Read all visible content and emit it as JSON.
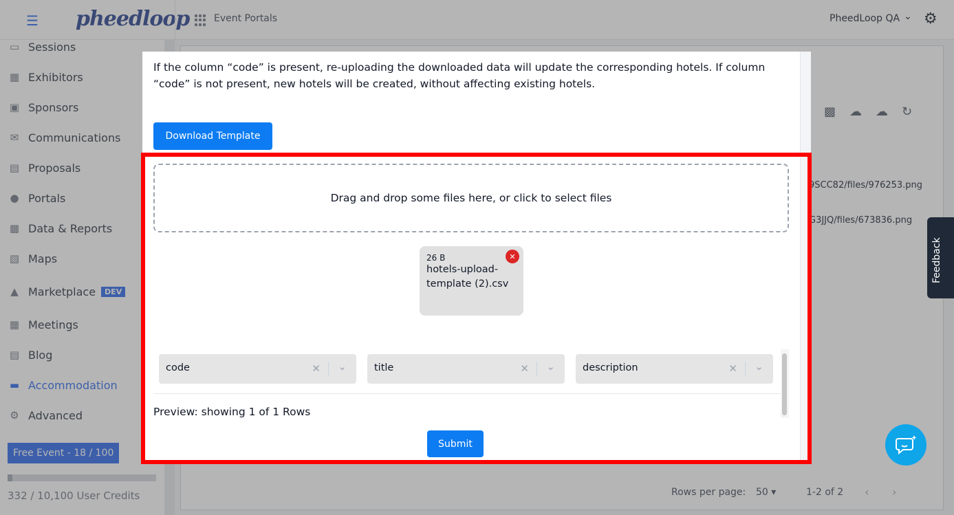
{
  "header": {
    "logo_text": "pheedloop",
    "portal_title": "Event Portals",
    "org_name": "PheedLoop QA"
  },
  "sidebar": {
    "items": [
      {
        "label": "Sessions",
        "icon": "monitor-icon"
      },
      {
        "label": "Exhibitors",
        "icon": "store-icon"
      },
      {
        "label": "Sponsors",
        "icon": "badge-icon"
      },
      {
        "label": "Communications",
        "icon": "mail-icon"
      },
      {
        "label": "Proposals",
        "icon": "document-icon"
      },
      {
        "label": "Portals",
        "icon": "globe-icon"
      },
      {
        "label": "Data & Reports",
        "icon": "chart-icon"
      },
      {
        "label": "Maps",
        "icon": "map-icon"
      },
      {
        "label": "Marketplace",
        "icon": "cart-icon",
        "badge": "DEV"
      },
      {
        "label": "Meetings",
        "icon": "calendar-icon"
      },
      {
        "label": "Blog",
        "icon": "document-icon"
      },
      {
        "label": "Accommodation",
        "icon": "bed-icon",
        "active": true
      },
      {
        "label": "Advanced",
        "icon": "gear-icon"
      }
    ],
    "free_event_label": "Free Event - 18 / 100",
    "credit_usage_fraction": 0.033,
    "credits_label": "332 / 10,100 User Credits"
  },
  "background": {
    "link_1": "9SCC82/files/976253.png",
    "link_2": "G3JJQ/files/673836.png",
    "feedback_label": "Feedback",
    "rows_per_page_label": "Rows per page:",
    "rows_per_page_value": "50",
    "range_label": "1-2 of 2"
  },
  "modal": {
    "info_text": "If the column “code” is present, re-uploading the downloaded data will update the corresponding hotels. If column “code” is not present, new hotels will be created, without affecting existing hotels.",
    "download_button": "Download Template",
    "dropzone_text": "Drag and drop some files here, or click to select files",
    "file": {
      "size": "26 B",
      "name": "hotels-upload-template (2).csv"
    },
    "column_mappings": [
      "code",
      "title",
      "description"
    ],
    "preview_text": "Preview: showing 1 of 1 Rows",
    "submit_button": "Submit"
  },
  "colors": {
    "primary": "#0d7cf2",
    "highlight": "#ff0000",
    "remove": "#dc2626"
  }
}
